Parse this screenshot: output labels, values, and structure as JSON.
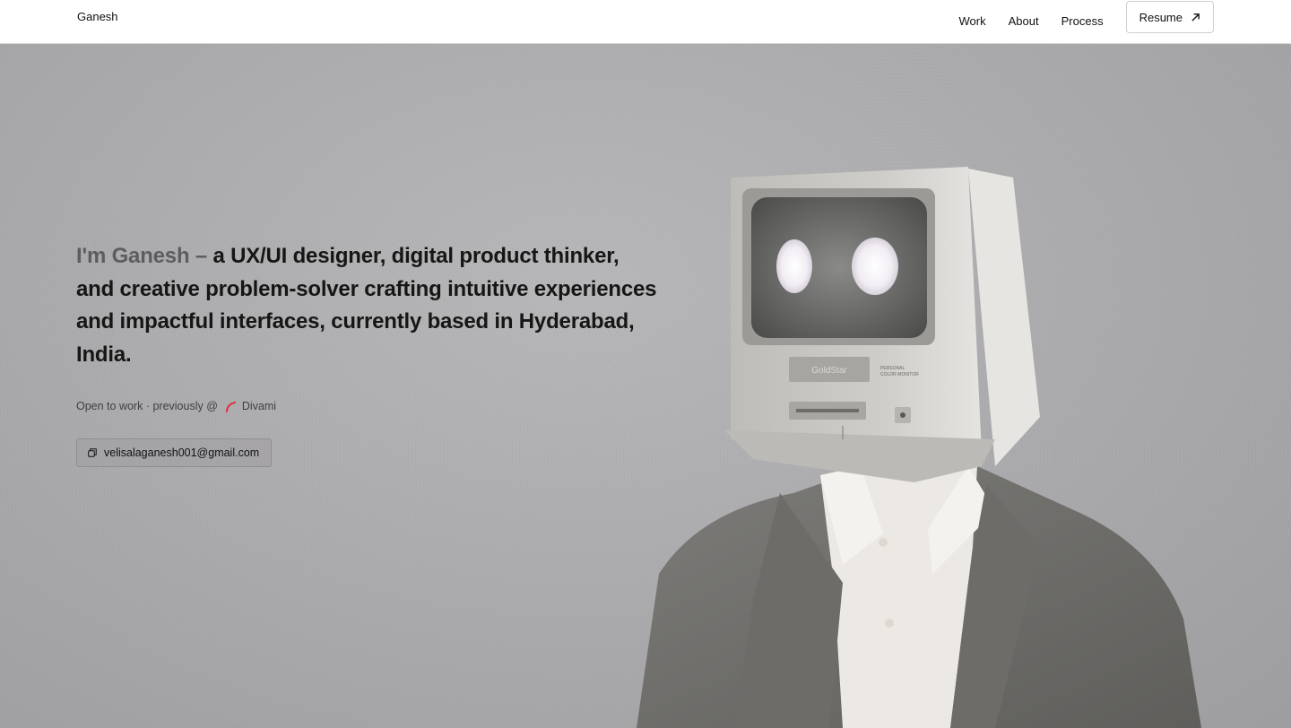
{
  "header": {
    "brand": "Ganesh",
    "nav": [
      {
        "label": "Work"
      },
      {
        "label": "About"
      },
      {
        "label": "Process"
      }
    ],
    "resume_label": "Resume",
    "resume_icon": "arrow-up-right-icon"
  },
  "hero": {
    "intro": "I'm Ganesh –",
    "headline": " a UX/UI designer, digital product thinker, and creative problem-solver crafting intuitive experiences and impactful interfaces, currently based in Hyderabad, India.",
    "status_text": "Open to work · previously @",
    "company_name": "Divami",
    "company_logo_color": "#e0283a",
    "email": "velisalaganesh001@gmail.com",
    "email_icon": "copy-icon",
    "image_description": "Person in grey blazer wearing a vintage GoldStar CRT monitor as a head",
    "monitor_label": "GoldStar",
    "monitor_sublabel_1": "PERSONAL",
    "monitor_sublabel_2": "COLOR MONITOR"
  }
}
